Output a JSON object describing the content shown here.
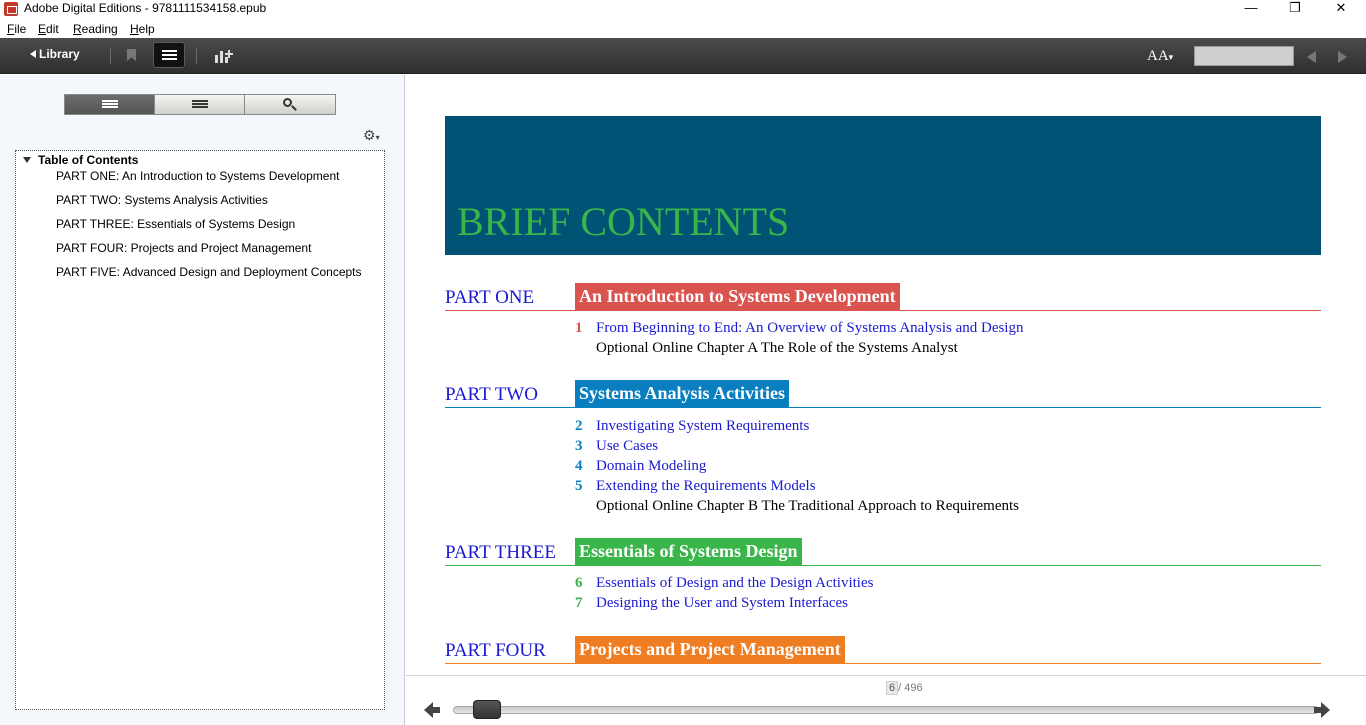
{
  "window": {
    "title": "Adobe Digital Editions - 9781111534158.epub",
    "minimize": "—",
    "restore": "❐",
    "close": "✕"
  },
  "menu": [
    "File",
    "Edit",
    "Reading",
    "Help"
  ],
  "toolbar": {
    "library_label": "Library",
    "font_size_label": "AA",
    "search_value": ""
  },
  "sidebar": {
    "tabs": [
      "toc",
      "bookmarks",
      "search"
    ],
    "gear": "⚙",
    "toc_root": "Table of Contents",
    "toc_items": [
      "PART ONE: An Introduction to Systems Development",
      "PART TWO: Systems Analysis Activities",
      "PART THREE: Essentials of Systems Design",
      "PART FOUR: Projects and Project Management",
      "PART FIVE: Advanced Design and Deployment Concepts"
    ]
  },
  "page": {
    "banner_title": "BRIEF CONTENTS",
    "banner_color": "#005374",
    "parts": [
      {
        "label": "PART ONE",
        "title": "An Introduction to Systems Development",
        "color": "#d9534f",
        "chapters": [
          {
            "num": "1",
            "text": "From Beginning to End: An Overview of Systems Analysis and Design"
          },
          {
            "num": "",
            "text": "Optional Online Chapter A The Role of the Systems Analyst"
          }
        ]
      },
      {
        "label": "PART TWO",
        "title": "Systems Analysis Activities",
        "color": "#0a7fc0",
        "chapters": [
          {
            "num": "2",
            "text": "Investigating System Requirements"
          },
          {
            "num": "3",
            "text": "Use Cases"
          },
          {
            "num": "4",
            "text": "Domain Modeling"
          },
          {
            "num": "5",
            "text": "Extending the Requirements Models"
          },
          {
            "num": "",
            "text": "Optional Online Chapter B The Traditional Approach to Requirements"
          }
        ]
      },
      {
        "label": "PART THREE",
        "title": "Essentials of Systems Design",
        "color": "#3ab54a",
        "chapters": [
          {
            "num": "6",
            "text": "Essentials of Design and the Design Activities"
          },
          {
            "num": "7",
            "text": "Designing the User and System Interfaces"
          }
        ]
      },
      {
        "label": "PART FOUR",
        "title": "Projects and Project Management",
        "color": "#ef7d22",
        "chapters": []
      }
    ]
  },
  "navigation": {
    "current_page": "6",
    "total_pages": "/ 496",
    "progress_fraction": 0.012
  }
}
